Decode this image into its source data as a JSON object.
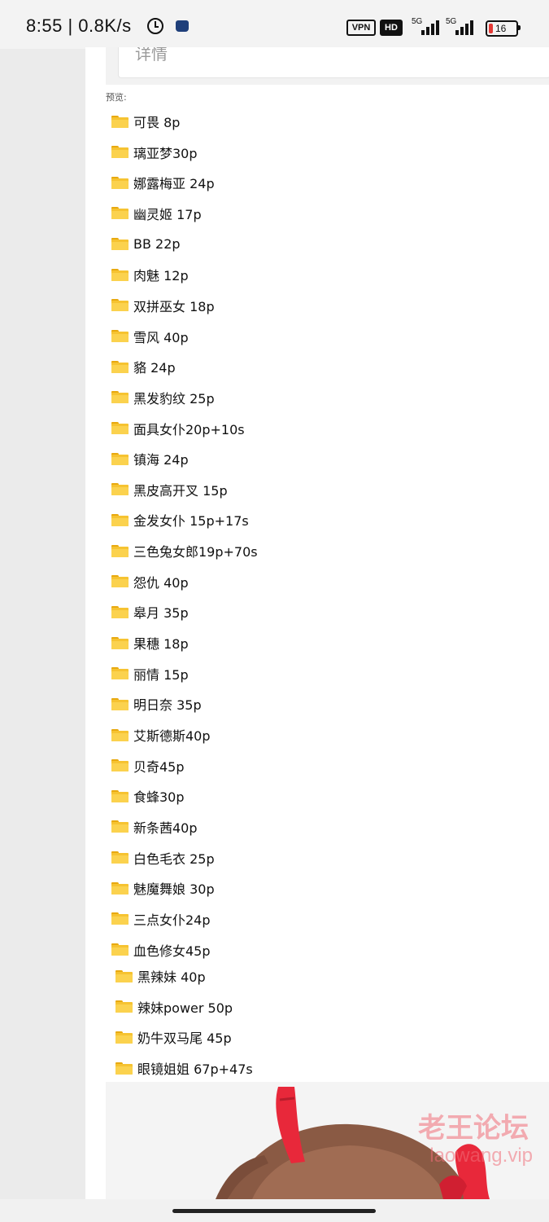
{
  "status_bar": {
    "time": "8:55",
    "separator": "|",
    "network_speed": "0.8K/s",
    "vpn": "VPN",
    "hd": "HD",
    "signal_label_1": "5G",
    "signal_label_2": "5G",
    "battery": "16",
    "battery_level": 0.16,
    "battery_color": "#e53935"
  },
  "details": {
    "label": "详情"
  },
  "preview_label": "预览:",
  "folders": [
    "可畏 8p",
    "璃亚梦30p",
    "娜露梅亚 24p",
    "幽灵姬 17p",
    "BB 22p",
    "肉魅 12p",
    "双拼巫女 18p",
    "雪风 40p",
    "貉 24p",
    "黑发豹纹 25p",
    "面具女仆20p+10s",
    "镇海 24p",
    "黑皮高开叉 15p",
    "金发女仆 15p+17s",
    "三色兔女郎19p+70s",
    "怨仇 40p",
    "皋月 35p",
    "果穗 18p",
    "丽情 15p",
    "明日奈 35p",
    "艾斯德斯40p",
    "贝奇45p",
    "食蜂30p",
    "新条茜40p",
    "白色毛衣 25p",
    "魅魔舞娘 30p",
    "三点女仆24p",
    "血色修女45p",
    "黑辣妹 40p",
    "辣妹power 50p",
    "奶牛双马尾 45p",
    "眼镜姐姐 67p+47s"
  ],
  "watermark": {
    "cn": "老王论坛",
    "url": "laowang.vip"
  },
  "colors": {
    "folder": "#f6c331",
    "ribbon": "#e8283a",
    "hair": "#8a5a44"
  },
  "icons": [
    "alarm-icon",
    "app-notification-icon",
    "folder-icon",
    "battery-icon"
  ]
}
